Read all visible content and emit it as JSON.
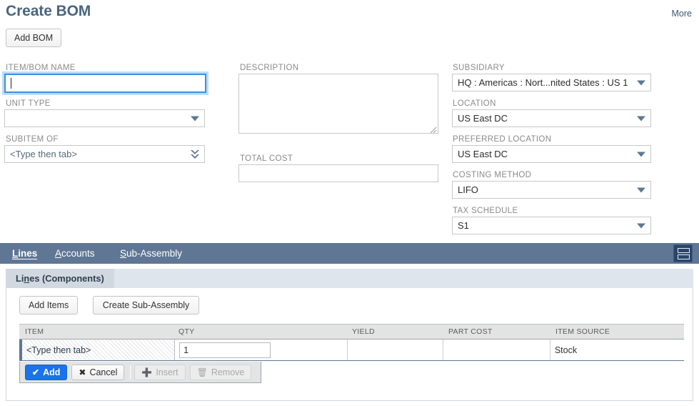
{
  "header": {
    "title": "Create BOM",
    "more_label": "More",
    "add_bom_label": "Add BOM"
  },
  "form": {
    "item_bom_name": {
      "label": "ITEM/BOM NAME",
      "value": "",
      "focused": true
    },
    "unit_type": {
      "label": "UNIT TYPE",
      "value": "",
      "icon": "chevron-down-icon"
    },
    "subitem_of": {
      "label": "SUBITEM OF",
      "value": "<Type then tab>",
      "icon": "double-chevron-down-icon"
    },
    "description": {
      "label": "DESCRIPTION",
      "value": ""
    },
    "total_cost": {
      "label": "TOTAL COST",
      "value": ""
    },
    "subsidiary": {
      "label": "SUBSIDIARY",
      "value": "HQ : Americas : Nort...nited States : US 1",
      "icon": "chevron-down-icon"
    },
    "location": {
      "label": "LOCATION",
      "value": "US East DC",
      "icon": "chevron-down-icon"
    },
    "preferred_location": {
      "label": "PREFERRED LOCATION",
      "value": "US East DC",
      "icon": "chevron-down-icon"
    },
    "costing_method": {
      "label": "COSTING METHOD",
      "value": "LIFO",
      "icon": "chevron-down-icon"
    },
    "tax_schedule": {
      "label": "TAX SCHEDULE",
      "value": "S1",
      "icon": "chevron-down-icon"
    }
  },
  "tabs": {
    "items": [
      {
        "accel": "L",
        "rest": "ines",
        "active": true
      },
      {
        "accel": "A",
        "rest": "ccounts",
        "active": false
      },
      {
        "accel": "S",
        "rest": "ub-Assembly",
        "active": false
      }
    ],
    "menu_icon": "list-view-icon"
  },
  "sublist": {
    "subtab": {
      "pre": "Li",
      "accel": "n",
      "post": "es (Components)",
      "full": "Lines (Components)"
    },
    "add_items_label": "Add Items",
    "create_subassembly_label": "Create Sub-Assembly",
    "columns": [
      "ITEM",
      "QTY",
      "YIELD",
      "PART COST",
      "ITEM SOURCE"
    ],
    "rows": [
      {
        "item": "<Type then tab>",
        "qty": "1",
        "yield": "",
        "part_cost": "",
        "item_source": "Stock"
      }
    ],
    "actions": [
      {
        "label": "Add",
        "icon": "check-icon",
        "state": "primary"
      },
      {
        "label": "Cancel",
        "icon": "x-icon",
        "state": "enabled"
      },
      {
        "label": "Insert",
        "icon": "plus-icon",
        "state": "disabled"
      },
      {
        "label": "Remove",
        "icon": "trash-icon",
        "state": "disabled"
      }
    ]
  },
  "colors": {
    "title": "#49657f",
    "tabstrip": "#5f7695",
    "primary_button": "#1a73e8",
    "focus_border": "#3f8fd9"
  }
}
